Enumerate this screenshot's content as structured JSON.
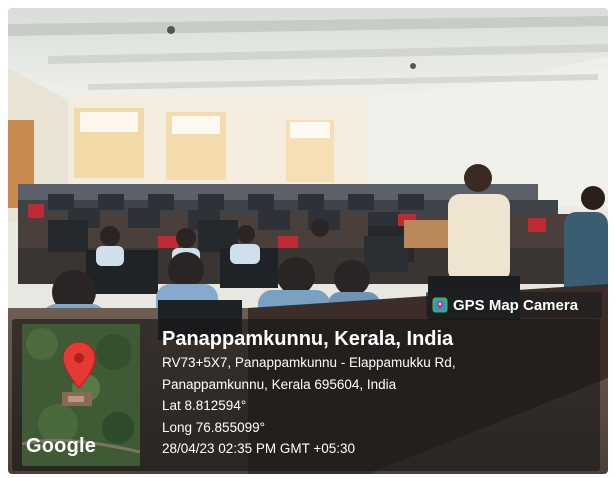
{
  "icons": {
    "camera": "map-pin-camera-icon",
    "pin": "location-pin-icon"
  },
  "colors": {
    "pin": "#e53935",
    "overlay": "#1e1e1e",
    "text": "#ffffff"
  },
  "stamp": {
    "app_label": "GPS Map Camera",
    "place_title": "Panappamkunnu, Kerala, India",
    "address_line1": "RV73+5X7, Panappamkunnu - Elappamukku Rd,",
    "address_line2": "Panappamkunnu, Kerala 695604, India",
    "latitude": "Lat 8.812594°",
    "longitude": "Long 76.855099°",
    "datetime": "28/04/23 02:35 PM GMT +05:30"
  },
  "map": {
    "provider_label": "Google"
  }
}
